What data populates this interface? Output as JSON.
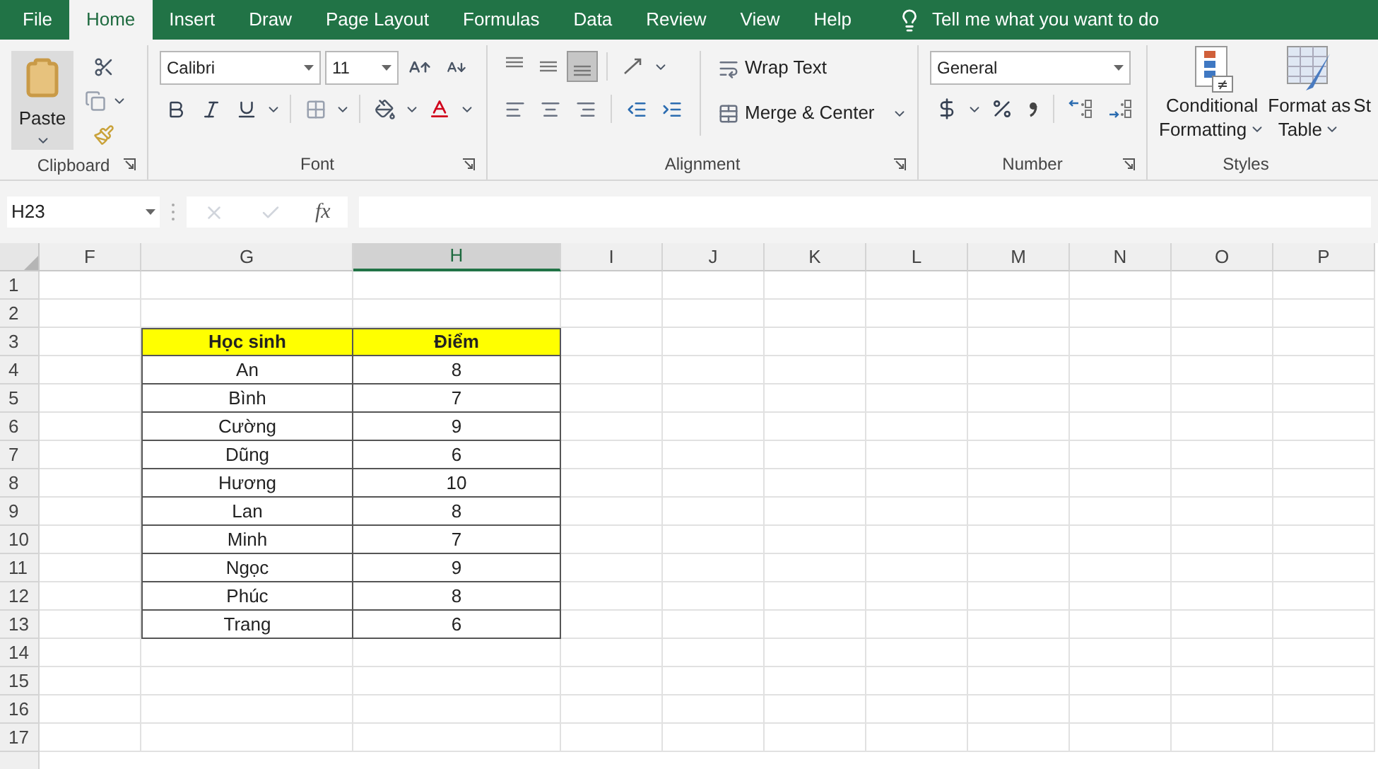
{
  "menu_tabs": [
    {
      "label": "File",
      "selected": false
    },
    {
      "label": "Home",
      "selected": true
    },
    {
      "label": "Insert",
      "selected": false
    },
    {
      "label": "Draw",
      "selected": false
    },
    {
      "label": "Page Layout",
      "selected": false
    },
    {
      "label": "Formulas",
      "selected": false
    },
    {
      "label": "Data",
      "selected": false
    },
    {
      "label": "Review",
      "selected": false
    },
    {
      "label": "View",
      "selected": false
    },
    {
      "label": "Help",
      "selected": false
    }
  ],
  "tell_me": "Tell me what you want to do",
  "ribbon": {
    "clipboard": {
      "paste": "Paste",
      "group_label": "Clipboard"
    },
    "font": {
      "font_name": "Calibri",
      "font_size": "11",
      "group_label": "Font"
    },
    "alignment": {
      "wrap_text": "Wrap Text",
      "merge": "Merge & Center",
      "group_label": "Alignment"
    },
    "number": {
      "format": "General",
      "group_label": "Number"
    },
    "styles": {
      "conditional_formatting": [
        "Conditional",
        "Formatting"
      ],
      "format_as_table": [
        "Format as",
        "Table"
      ],
      "cell_styles": "St",
      "group_label": "Styles"
    }
  },
  "formula_bar": {
    "name_box": "H23",
    "fx": "fx"
  },
  "sheet": {
    "columns": [
      {
        "label": "F",
        "selected": false
      },
      {
        "label": "G",
        "selected": false
      },
      {
        "label": "H",
        "selected": true
      },
      {
        "label": "I",
        "selected": false
      },
      {
        "label": "J",
        "selected": false
      },
      {
        "label": "K",
        "selected": false
      },
      {
        "label": "L",
        "selected": false
      },
      {
        "label": "M",
        "selected": false
      },
      {
        "label": "N",
        "selected": false
      },
      {
        "label": "O",
        "selected": false
      },
      {
        "label": "P",
        "selected": false
      }
    ],
    "rows": [
      "1",
      "2",
      "3",
      "4",
      "5",
      "6",
      "7",
      "8",
      "9",
      "10",
      "11",
      "12",
      "13",
      "14",
      "15",
      "16",
      "17"
    ],
    "table": {
      "header": [
        "Học sinh",
        "Điểm"
      ],
      "rows": [
        [
          "An",
          "8"
        ],
        [
          "Bình",
          "7"
        ],
        [
          "Cường",
          "9"
        ],
        [
          "Dũng",
          "6"
        ],
        [
          "Hương",
          "10"
        ],
        [
          "Lan",
          "8"
        ],
        [
          "Minh",
          "7"
        ],
        [
          "Ngọc",
          "9"
        ],
        [
          "Phúc",
          "8"
        ],
        [
          "Trang",
          "6"
        ]
      ]
    }
  }
}
